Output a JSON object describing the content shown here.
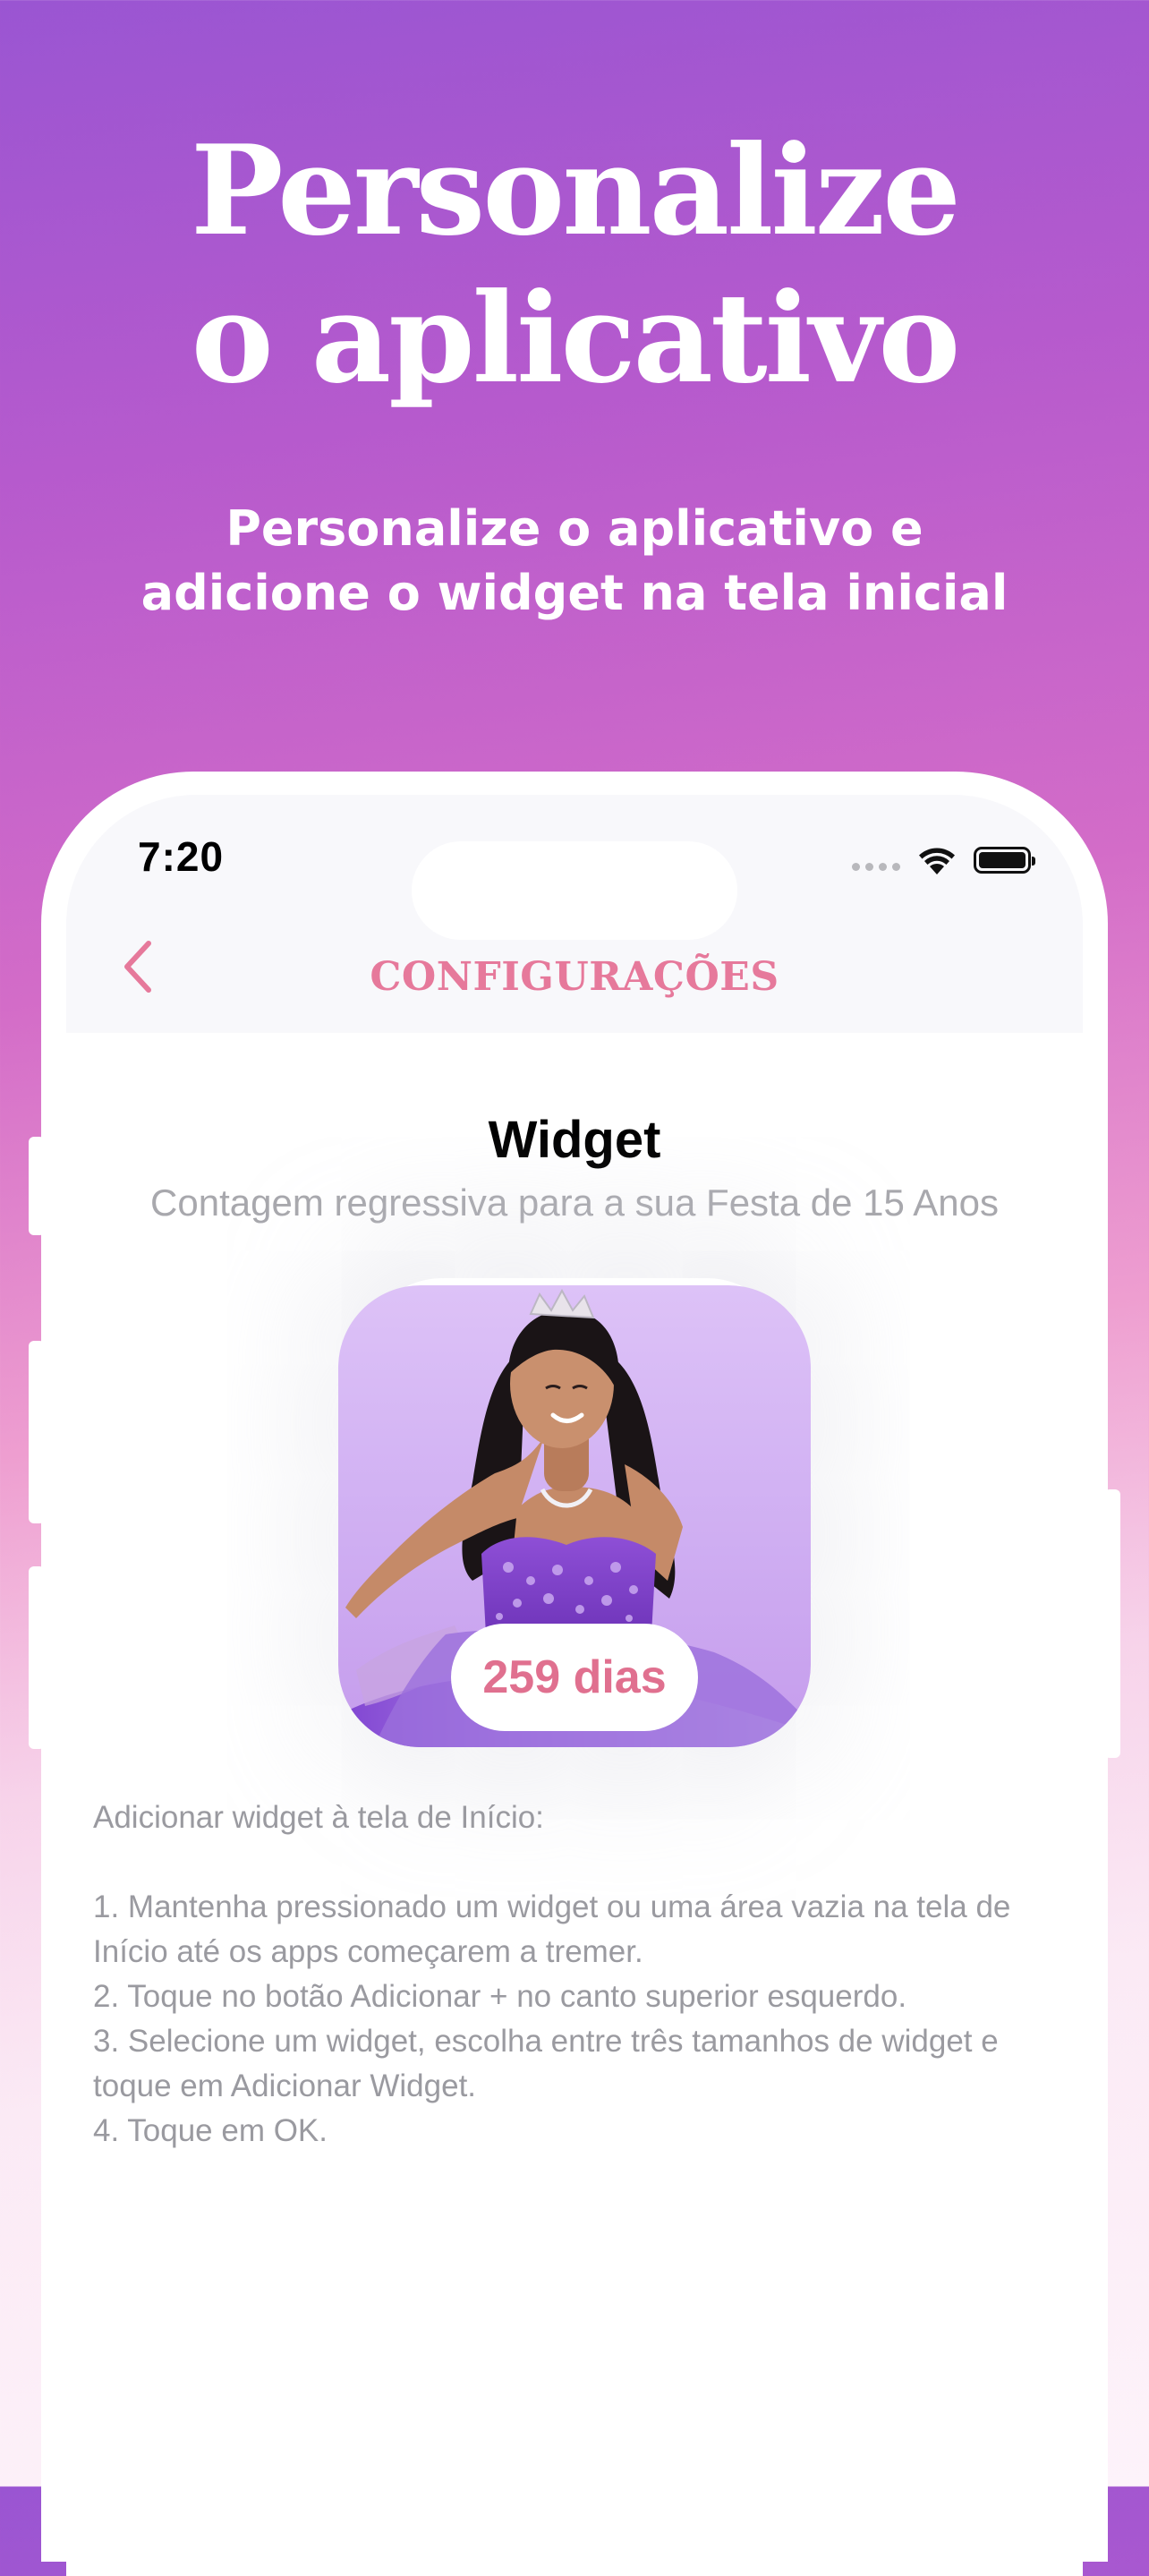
{
  "headline": {
    "line1": "Personalize",
    "line2": "o aplicativo"
  },
  "subhead": {
    "line1": "Personalize o aplicativo e",
    "line2": "adicione o widget na tela inicial"
  },
  "status_bar": {
    "time": "7:20"
  },
  "nav": {
    "title": "CONFIGURAÇÕES",
    "back_icon": "chevron-left-icon"
  },
  "widget": {
    "title": "Widget",
    "subtitle": "Contagem regressiva para a sua Festa de 15 Anos",
    "days_label": "259 dias"
  },
  "instructions": {
    "heading": "Adicionar widget à tela de Início:",
    "steps": [
      "1. Mantenha pressionado um widget ou uma área vazia na tela de Início até os apps começarem a tremer.",
      "2. Toque no botão Adicionar + no canto superior esquerdo.",
      "3. Selecione um widget, escolha entre três tamanhos de widget e toque em Adicionar Widget.",
      "4. Toque em OK."
    ]
  },
  "colors": {
    "accent": "#e6799b",
    "background_top": "#9a55d2",
    "background_bottom": "#fdf3fa"
  }
}
